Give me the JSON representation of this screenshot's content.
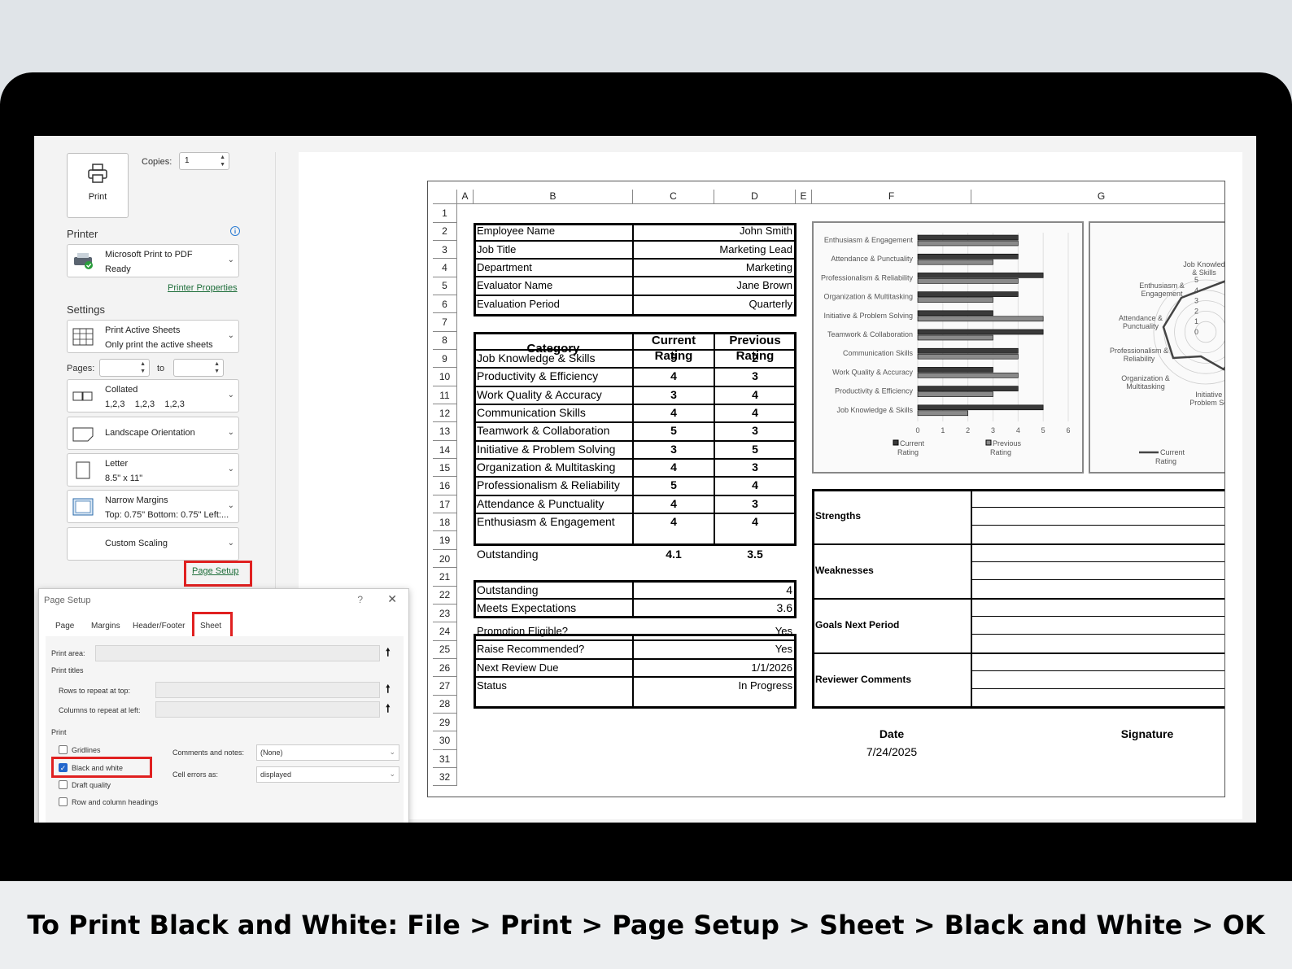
{
  "print_panel": {
    "print_label": "Print",
    "copies_label": "Copies:",
    "copies_value": "1",
    "printer_heading": "Printer",
    "printer_name": "Microsoft Print to PDF",
    "printer_status": "Ready",
    "printer_properties": "Printer Properties",
    "settings_heading": "Settings",
    "print_what": {
      "title": "Print Active Sheets",
      "sub": "Only print the active sheets"
    },
    "pages_label": "Pages:",
    "to_label": "to",
    "collated": {
      "title": "Collated",
      "sub": "1,2,3    1,2,3    1,2,3"
    },
    "orientation": "Landscape Orientation",
    "paper": {
      "title": "Letter",
      "sub": "8.5\" x 11\""
    },
    "margins": {
      "title": "Narrow Margins",
      "sub": "Top: 0.75\" Bottom: 0.75\" Left:..."
    },
    "scaling": "Custom Scaling",
    "page_setup_link": "Page Setup"
  },
  "dialog": {
    "title": "Page Setup",
    "help": "?",
    "close": "✕",
    "tabs": [
      "Page",
      "Margins",
      "Header/Footer",
      "Sheet"
    ],
    "print_area_label": "Print area:",
    "print_titles_label": "Print titles",
    "rows_repeat_label": "Rows to repeat at top:",
    "cols_repeat_label": "Columns to repeat at left:",
    "print_group_label": "Print",
    "gridlines": "Gridlines",
    "black_white": "Black and white",
    "draft": "Draft quality",
    "row_col_headings": "Row and column headings",
    "comments_label": "Comments and notes:",
    "comments_value": "(None)",
    "cell_errors_label": "Cell errors as:",
    "cell_errors_value": "displayed",
    "checkbox_checked": "✓"
  },
  "sheet": {
    "columns": [
      "A",
      "B",
      "C",
      "D",
      "E",
      "F",
      "G"
    ],
    "rows": [
      "1",
      "2",
      "3",
      "4",
      "5",
      "6",
      "7",
      "8",
      "9",
      "10",
      "11",
      "12",
      "13",
      "14",
      "15",
      "16",
      "17",
      "18",
      "19",
      "20",
      "21",
      "22",
      "23",
      "24",
      "25",
      "26",
      "27",
      "28",
      "29",
      "30",
      "31",
      "32"
    ],
    "info": [
      {
        "label": "Employee Name",
        "value": "John Smith"
      },
      {
        "label": "Job Title",
        "value": "Marketing Lead"
      },
      {
        "label": "Department",
        "value": "Marketing"
      },
      {
        "label": "Evaluator Name",
        "value": "Jane Brown"
      },
      {
        "label": "Evaluation Period",
        "value": "Quarterly"
      }
    ],
    "ratings_header": {
      "category": "Category",
      "current": "Current Rating",
      "previous": "Previous Rating"
    },
    "ratings": [
      {
        "category": "Job Knowledge & Skills",
        "current": "5",
        "previous": "2"
      },
      {
        "category": "Productivity & Efficiency",
        "current": "4",
        "previous": "3"
      },
      {
        "category": "Work Quality & Accuracy",
        "current": "3",
        "previous": "4"
      },
      {
        "category": "Communication Skills",
        "current": "4",
        "previous": "4"
      },
      {
        "category": "Teamwork & Collaboration",
        "current": "5",
        "previous": "3"
      },
      {
        "category": "Initiative & Problem Solving",
        "current": "3",
        "previous": "5"
      },
      {
        "category": "Organization & Multitasking",
        "current": "4",
        "previous": "3"
      },
      {
        "category": "Professionalism & Reliability",
        "current": "5",
        "previous": "4"
      },
      {
        "category": "Attendance & Punctuality",
        "current": "4",
        "previous": "3"
      },
      {
        "category": "Enthusiasm & Engagement",
        "current": "4",
        "previous": "4"
      }
    ],
    "summary": {
      "label": "Outstanding",
      "current": "4.1",
      "previous": "3.5"
    },
    "overall": [
      {
        "label": "Outstanding",
        "value": "4"
      },
      {
        "label": "Meets Expectations",
        "value": "3.6"
      }
    ],
    "status": [
      {
        "label": "Promotion Eligible?",
        "value": "Yes"
      },
      {
        "label": "Raise Recommended?",
        "value": "Yes"
      },
      {
        "label": "Next Review Due",
        "value": "1/1/2026"
      },
      {
        "label": "Status",
        "value": "In Progress"
      }
    ],
    "notes": [
      "Strengths",
      "Weaknesses",
      "Goals Next Period",
      "Reviewer Comments"
    ],
    "date_label": "Date",
    "date_value": "7/24/2025",
    "signature_label": "Signature"
  },
  "chart_data": [
    {
      "type": "bar",
      "orientation": "horizontal",
      "categories": [
        "Enthusiasm & Engagement",
        "Attendance & Punctuality",
        "Professionalism & Reliability",
        "Organization & Multitasking",
        "Initiative & Problem Solving",
        "Teamwork & Collaboration",
        "Communication Skills",
        "Work Quality & Accuracy",
        "Productivity & Efficiency",
        "Job Knowledge & Skills"
      ],
      "series": [
        {
          "name": "Current Rating",
          "values": [
            4,
            4,
            5,
            4,
            3,
            5,
            4,
            3,
            4,
            5
          ]
        },
        {
          "name": "Previous Rating",
          "values": [
            4,
            3,
            4,
            3,
            5,
            3,
            4,
            4,
            3,
            2
          ]
        }
      ],
      "xlim": [
        0,
        6
      ],
      "xticks": [
        "0",
        "1",
        "2",
        "3",
        "4",
        "5",
        "6"
      ],
      "legend": "bottom",
      "colors": {
        "current": "#3a3a3a",
        "previous": "#8a8a8a"
      }
    },
    {
      "type": "radar",
      "categories_visible": [
        "Job Knowled & Skills",
        "Enthusiasm & Engagement",
        "Attendance & Punctuality",
        "Professionalism & Reliability",
        "Organization & Multitasking",
        "Initiative & Problem Solvi"
      ],
      "ticks": [
        "5",
        "4",
        "3",
        "2",
        "1",
        "0"
      ],
      "series": [
        {
          "name": "Current Rating"
        }
      ],
      "legend": "bottom"
    }
  ],
  "caption": "To Print Black and White: File > Print > Page Setup > Sheet > Black and White > OK"
}
